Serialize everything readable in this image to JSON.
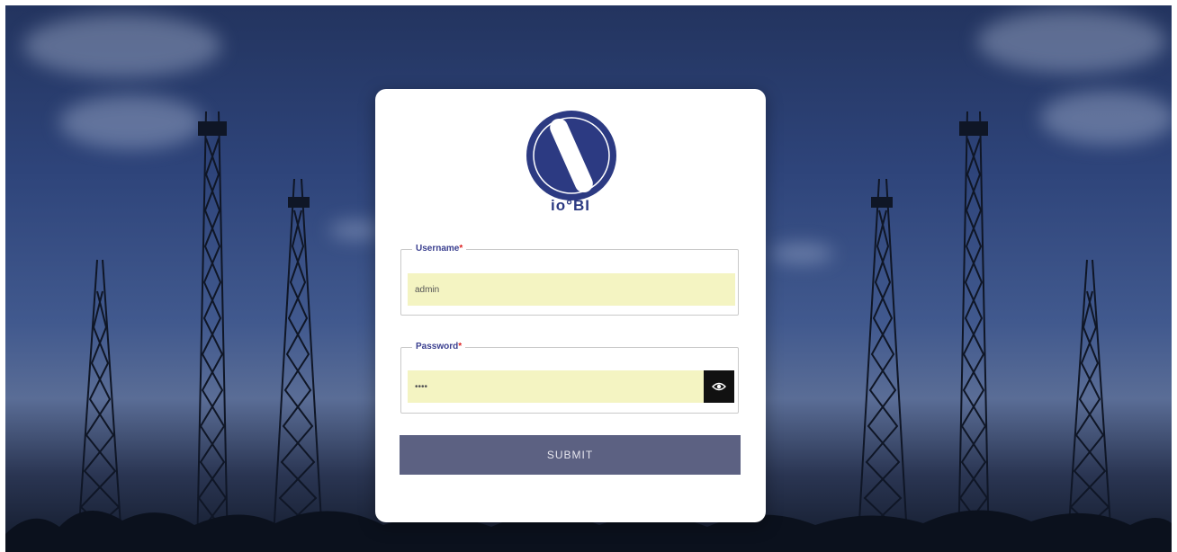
{
  "brand": {
    "logo_text": "io°BI",
    "accent": "#2c3a82"
  },
  "form": {
    "username": {
      "label": "Username",
      "required_mark": "*",
      "value": "admin",
      "placeholder": ""
    },
    "password": {
      "label": "Password",
      "required_mark": "*",
      "value": "••••",
      "placeholder": "",
      "toggle_icon": "eye-icon"
    },
    "submit_label": "SUBMIT",
    "submit_color": "#5c6182",
    "input_bg": "#f4f4c2"
  }
}
